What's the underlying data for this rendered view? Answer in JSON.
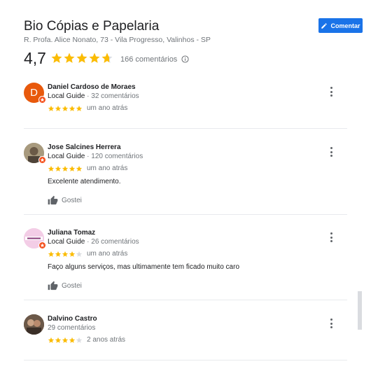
{
  "business": {
    "name": "Bio Cópias e Papelaria",
    "address": "R. Profa. Alice Nonato, 73 - Vila Progresso, Valinhos - SP",
    "comment_button": "Comentar",
    "rating": "4,7",
    "rating_value": 4.7,
    "review_count": "166 comentários"
  },
  "colors": {
    "star": "#fbbc04",
    "star_empty": "#dadce0",
    "button": "#1a73e8",
    "badge": "#f4511e"
  },
  "reviews": [
    {
      "name": "Daniel Cardoso de Moraes",
      "guide": "Local Guide",
      "comments": "32 comentários",
      "stars": 5,
      "date": "um ano atrás",
      "text": "",
      "like": "",
      "avatar_letter": "D",
      "avatar_color": "#e8590c",
      "is_guide": true
    },
    {
      "name": "Jose Salcines Herrera",
      "guide": "Local Guide",
      "comments": "120 comentários",
      "stars": 5,
      "date": "um ano atrás",
      "text": "Excelente atendimento.",
      "like": "Gostei",
      "avatar_letter": "",
      "avatar_color": "#7a6a55",
      "is_guide": true
    },
    {
      "name": "Juliana Tomaz",
      "guide": "Local Guide",
      "comments": "26 comentários",
      "stars": 4,
      "date": "um ano atrás",
      "text": "Faço alguns serviços, mas ultimamente tem ficado muito caro",
      "like": "Gostei",
      "avatar_letter": "",
      "avatar_color": "#f1c4e0",
      "is_guide": true
    },
    {
      "name": "Dalvino Castro",
      "guide": "",
      "comments": "29 comentários",
      "stars": 4,
      "date": "2 anos atrás",
      "text": "",
      "like": "",
      "avatar_letter": "",
      "avatar_color": "#5b4a3e",
      "is_guide": false
    }
  ]
}
